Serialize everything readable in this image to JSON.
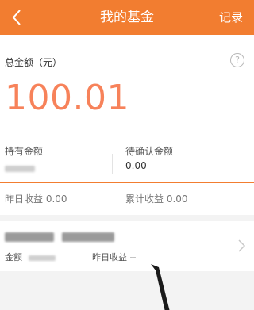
{
  "navbar": {
    "title": "我的基金",
    "right_label": "记录",
    "background": "#f27d30"
  },
  "summary": {
    "total_label": "总金额（元）",
    "total_value": "100.01",
    "help_glyph": "?",
    "holding_label": "持有金额",
    "pending_label": "待确认金额",
    "pending_value": "0.00"
  },
  "income": {
    "yesterday_label": "昨日收益",
    "yesterday_value": "0.00",
    "cumulative_label": "累计收益",
    "cumulative_value": "0.00"
  },
  "fund": {
    "amount_label": "金额",
    "yesterday_label": "昨日收益",
    "yesterday_value": "--"
  },
  "colors": {
    "accent": "#f27d30",
    "total_value": "#f7825a"
  }
}
